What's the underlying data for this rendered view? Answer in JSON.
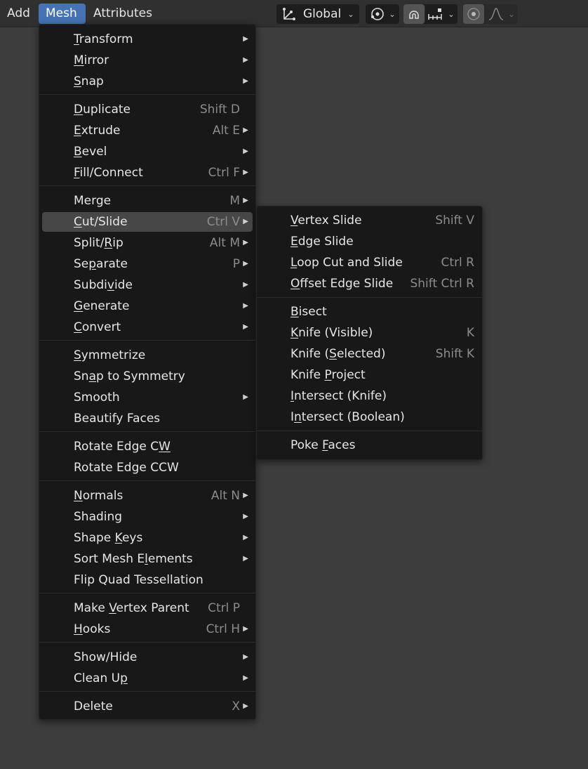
{
  "header": {
    "menus": [
      "Add",
      "Mesh",
      "Attributes"
    ],
    "orientation": "Global",
    "icons": [
      "transform-orientation-icon",
      "pivot-icon",
      "snap-icon",
      "snap-increment-icon",
      "proportional-edit-icon",
      "falloff-curve-icon"
    ]
  },
  "colors": {
    "accent": "#4772b3",
    "menu_bg": "#181818",
    "highlight": "#474747",
    "viewport": "#3d3d3d"
  },
  "mesh_menu": {
    "items": [
      {
        "label": "Transform",
        "u": 0,
        "shortcut": "",
        "submenu": true
      },
      {
        "label": "Mirror",
        "u": 0,
        "shortcut": "",
        "submenu": true
      },
      {
        "label": "Snap",
        "u": 0,
        "shortcut": "",
        "submenu": true
      },
      {
        "label": "Duplicate",
        "u": 0,
        "shortcut": "Shift D",
        "submenu": false
      },
      {
        "label": "Extrude",
        "u": 0,
        "shortcut": "Alt E",
        "submenu": true
      },
      {
        "label": "Bevel",
        "u": 0,
        "shortcut": "",
        "submenu": true
      },
      {
        "label": "Fill/Connect",
        "u": 0,
        "shortcut": "Ctrl F",
        "submenu": true
      },
      {
        "label": "Merge",
        "u": -1,
        "shortcut": "M",
        "submenu": true
      },
      {
        "label": "Cut/Slide",
        "u": 0,
        "shortcut": "Ctrl V",
        "submenu": true,
        "highlighted": true
      },
      {
        "label": "Split/Rip",
        "u": 6,
        "shortcut": "Alt M",
        "submenu": true
      },
      {
        "label": "Separate",
        "u": 2,
        "shortcut": "P",
        "submenu": true
      },
      {
        "label": "Subdivide",
        "u": 5,
        "shortcut": "",
        "submenu": true
      },
      {
        "label": "Generate",
        "u": 0,
        "shortcut": "",
        "submenu": true
      },
      {
        "label": "Convert",
        "u": 0,
        "shortcut": "",
        "submenu": true
      },
      {
        "label": "Symmetrize",
        "u": 0,
        "shortcut": "",
        "submenu": false
      },
      {
        "label": "Snap to Symmetry",
        "u": 2,
        "shortcut": "",
        "submenu": false
      },
      {
        "label": "Smooth",
        "u": -1,
        "shortcut": "",
        "submenu": true
      },
      {
        "label": "Beautify Faces",
        "u": -1,
        "shortcut": "",
        "submenu": false
      },
      {
        "label": "Rotate Edge CW",
        "u": 13,
        "shortcut": "",
        "submenu": false
      },
      {
        "label": "Rotate Edge CCW",
        "u": -1,
        "shortcut": "",
        "submenu": false
      },
      {
        "label": "Normals",
        "u": 0,
        "shortcut": "Alt N",
        "submenu": true
      },
      {
        "label": "Shading",
        "u": -1,
        "shortcut": "",
        "submenu": true
      },
      {
        "label": "Shape Keys",
        "u": 6,
        "shortcut": "",
        "submenu": true
      },
      {
        "label": "Sort Mesh Elements",
        "u": 11,
        "shortcut": "",
        "submenu": true
      },
      {
        "label": "Flip Quad Tessellation",
        "u": -1,
        "shortcut": "",
        "submenu": false
      },
      {
        "label": "Make Vertex Parent",
        "u": 5,
        "shortcut": "Ctrl P",
        "submenu": false
      },
      {
        "label": "Hooks",
        "u": 0,
        "shortcut": "Ctrl H",
        "submenu": true
      },
      {
        "label": "Show/Hide",
        "u": -1,
        "shortcut": "",
        "submenu": true
      },
      {
        "label": "Clean Up",
        "u": 7,
        "shortcut": "",
        "submenu": true
      },
      {
        "label": "Delete",
        "u": -1,
        "shortcut": "X",
        "submenu": true
      }
    ]
  },
  "cut_slide_menu": {
    "items": [
      {
        "label": "Vertex Slide",
        "u": 0,
        "shortcut": "Shift V",
        "submenu": false
      },
      {
        "label": "Edge Slide",
        "u": 0,
        "shortcut": "",
        "submenu": false
      },
      {
        "label": "Loop Cut and Slide",
        "u": 0,
        "shortcut": "Ctrl R",
        "submenu": false
      },
      {
        "label": "Offset Edge Slide",
        "u": 0,
        "shortcut": "Shift Ctrl R",
        "submenu": false
      },
      {
        "label": "Bisect",
        "u": 0,
        "shortcut": "",
        "submenu": false
      },
      {
        "label": "Knife (Visible)",
        "u": 0,
        "shortcut": "K",
        "submenu": false
      },
      {
        "label": "Knife (Selected)",
        "u": 7,
        "shortcut": "Shift K",
        "submenu": false
      },
      {
        "label": "Knife Project",
        "u": 6,
        "shortcut": "",
        "submenu": false
      },
      {
        "label": "Intersect (Knife)",
        "u": 0,
        "shortcut": "",
        "submenu": false
      },
      {
        "label": "Intersect (Boolean)",
        "u": 1,
        "shortcut": "",
        "submenu": false
      },
      {
        "label": "Poke Faces",
        "u": 5,
        "shortcut": "",
        "submenu": false
      }
    ]
  }
}
